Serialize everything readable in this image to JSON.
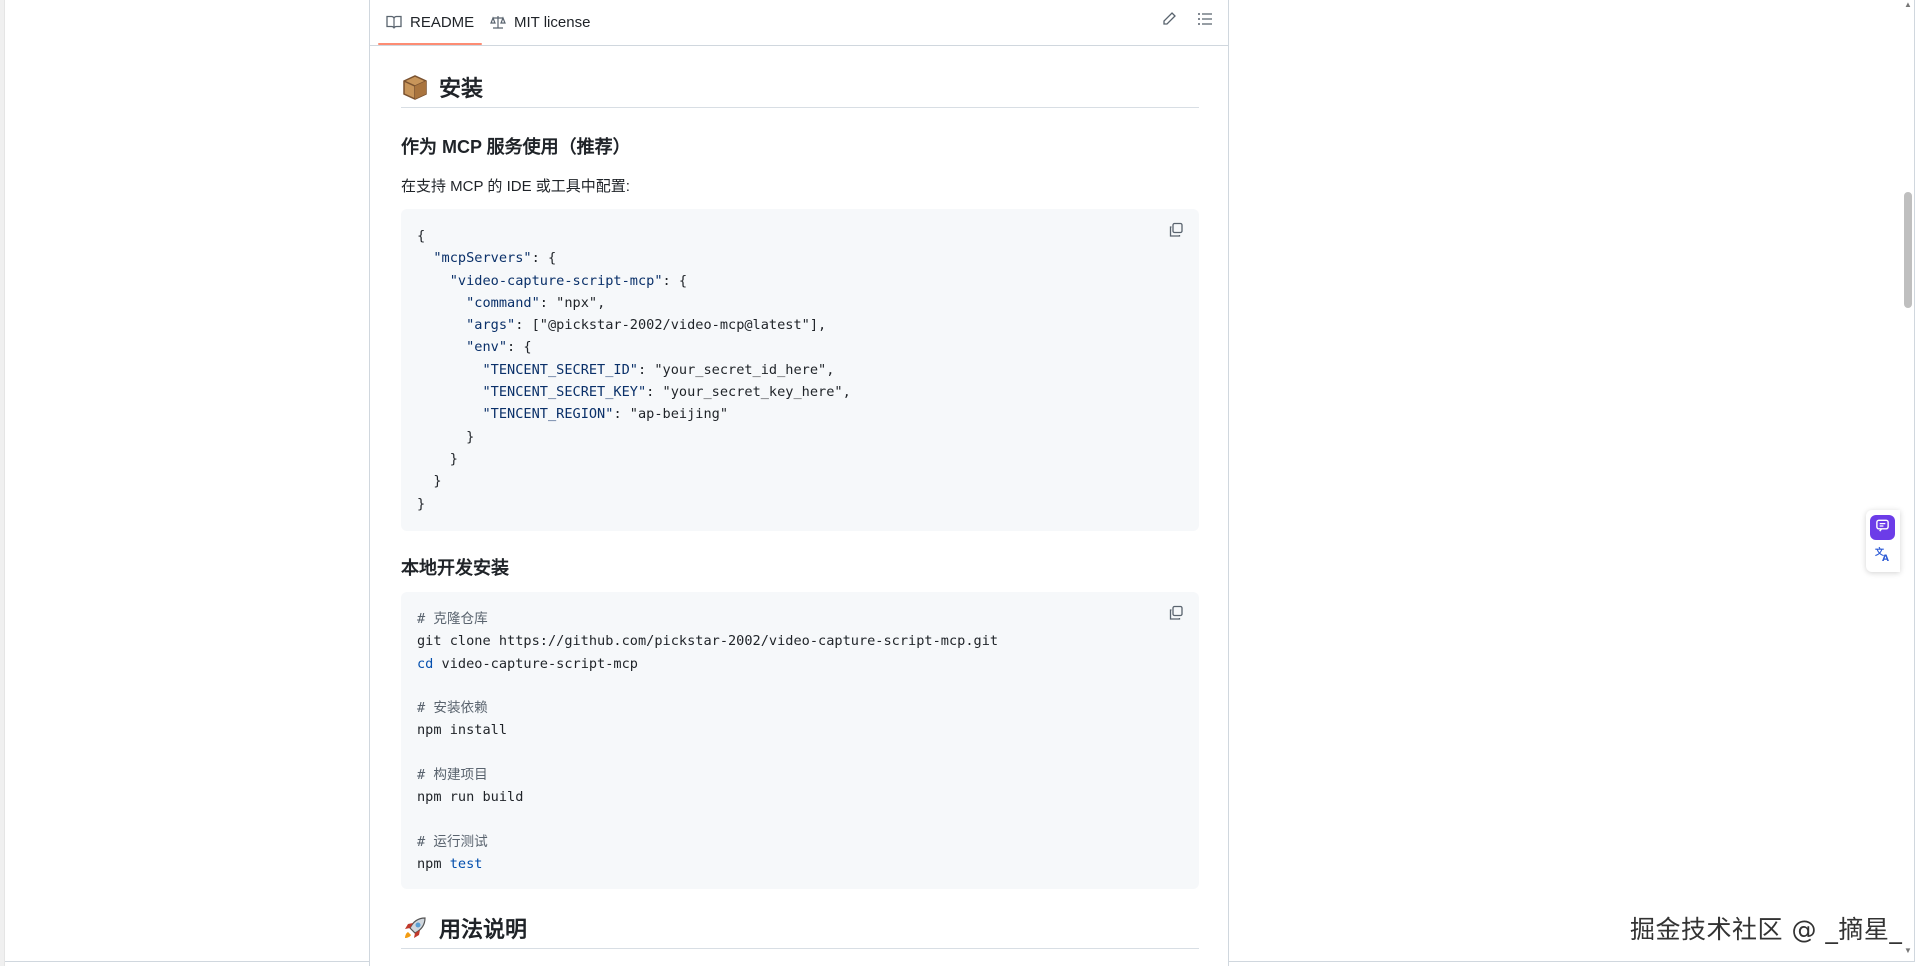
{
  "tabs": {
    "readme_label": "README",
    "license_label": "MIT license"
  },
  "sections": {
    "install_heading": "安装",
    "mcp_heading": "作为 MCP 服务使用（推荐）",
    "mcp_desc": "在支持 MCP 的 IDE 或工具中配置:",
    "local_heading": "本地开发安装",
    "usage_heading": "用法说明"
  },
  "code_mcp": {
    "lines": [
      "{",
      "  \"mcpServers\": {",
      "    \"video-capture-script-mcp\": {",
      "      \"command\": \"npx\",",
      "      \"args\": [\"@pickstar-2002/video-mcp@latest\"],",
      "      \"env\": {",
      "        \"TENCENT_SECRET_ID\": \"your_secret_id_here\",",
      "        \"TENCENT_SECRET_KEY\": \"your_secret_key_here\",",
      "        \"TENCENT_REGION\": \"ap-beijing\"",
      "      }",
      "    }",
      "  }",
      "}"
    ]
  },
  "code_local": {
    "lines": [
      "# 克隆仓库",
      "git clone https://github.com/pickstar-2002/video-capture-script-mcp.git",
      "cd video-capture-script-mcp",
      "",
      "# 安装依赖",
      "npm install",
      "",
      "# 构建项目",
      "npm run build",
      "",
      "# 运行测试",
      "npm test"
    ]
  },
  "watermark": "掘金技术社区 @ _摘星_",
  "colors": {
    "tab_underline": "#fd8c73",
    "code_bg": "#f6f8fa",
    "string_key": "#0a3069",
    "command": "#0550ae",
    "widget_accent": "#6c3ce8"
  },
  "icons": [
    "book-icon",
    "scale-icon",
    "pencil-icon",
    "list-icon",
    "copy-icon",
    "package-emoji-icon",
    "rocket-emoji-icon",
    "chat-icon",
    "translate-icon"
  ]
}
